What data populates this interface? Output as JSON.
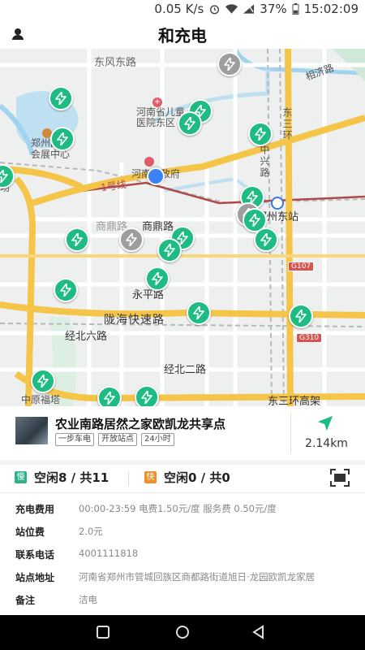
{
  "status_bar": {
    "speed": "0.05 K/s",
    "battery": "37%",
    "time": "15:02:09"
  },
  "app": {
    "title": "和充电"
  },
  "map": {
    "labels": {
      "dongfeng_rd": "东风东路",
      "xiangji_rd": "相济路",
      "hospital": "河南省儿童\n医院东区",
      "dongsanhuan": "东三环",
      "zhengzhou_conv": "郑州国\n会展中心",
      "zhongxing_rd": "中兴路",
      "province_gov": "河南省政府",
      "chang": "场",
      "line1": "1号线",
      "shangding_rd_big": "商鼎路",
      "shangding_rd": "商鼎路",
      "zhengzhou_east": "郑州东站",
      "g107": "G107",
      "yongping_rd": "永平路",
      "longhai_expwy": "陇海快速路",
      "g310": "G310",
      "jingbei6_rd": "经北六路",
      "jingbei2_rd": "经北二路",
      "zhongyuan_futa": "中原福塔",
      "dongsanhuan_elev": "东三环高架"
    },
    "station_icon": "lightning-bolt-icon"
  },
  "station": {
    "name": "农业南路居然之家欧凯龙共享点",
    "tags": [
      "一步车电",
      "开放站点",
      "24小时"
    ],
    "distance": "2.14km"
  },
  "availability": {
    "slow_badge": "慢",
    "slow_text": "空闲8 / 共11",
    "fast_badge": "快",
    "fast_text": "空闲0 / 共0"
  },
  "info": [
    {
      "label": "充电费用",
      "value": "00:00-23:59 电费1.50元/度 服务费 0.50元/度"
    },
    {
      "label": "站位费",
      "value": "2.0元"
    },
    {
      "label": "联系电话",
      "value": "4001111818"
    },
    {
      "label": "站点地址",
      "value": "河南省郑州市管城回族区商都路街道旭日·龙园欧凯龙家居"
    },
    {
      "label": "备注",
      "value": "洁电"
    }
  ],
  "colors": {
    "station_green": "#1ebb83",
    "station_grey": "#9e9e9e",
    "highway": "#f5c54a",
    "nav_bar": "#000000"
  }
}
